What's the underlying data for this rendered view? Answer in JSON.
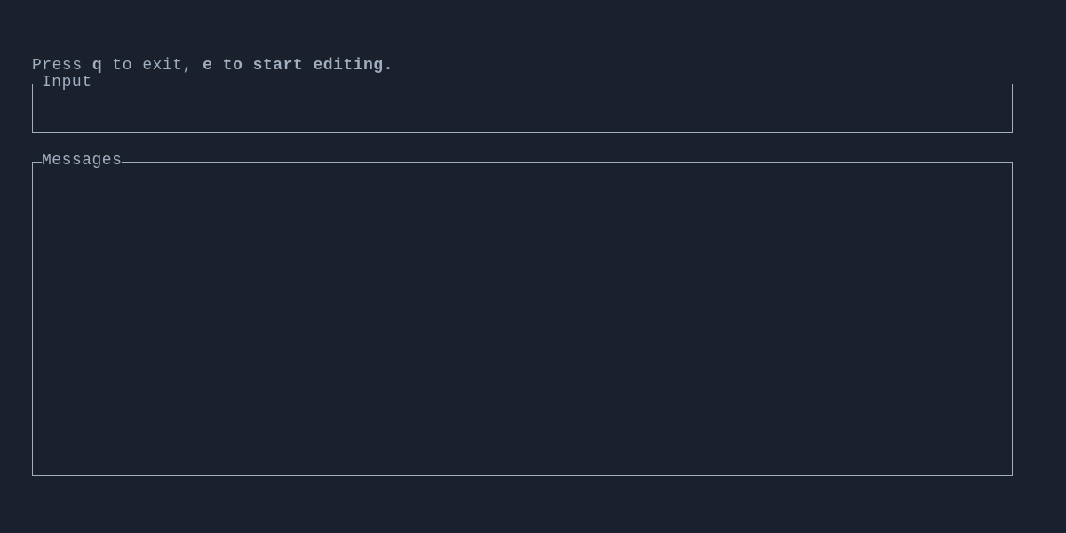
{
  "hint": {
    "prefix": "Press ",
    "key1": "q",
    "mid1": " to exit, ",
    "key2": "e",
    "suffix": " to start editing."
  },
  "panels": {
    "input": {
      "label": "Input",
      "value": ""
    },
    "messages": {
      "label": "Messages",
      "content": ""
    }
  },
  "colors": {
    "background": "#1a202c",
    "foreground": "#a0aec0"
  }
}
